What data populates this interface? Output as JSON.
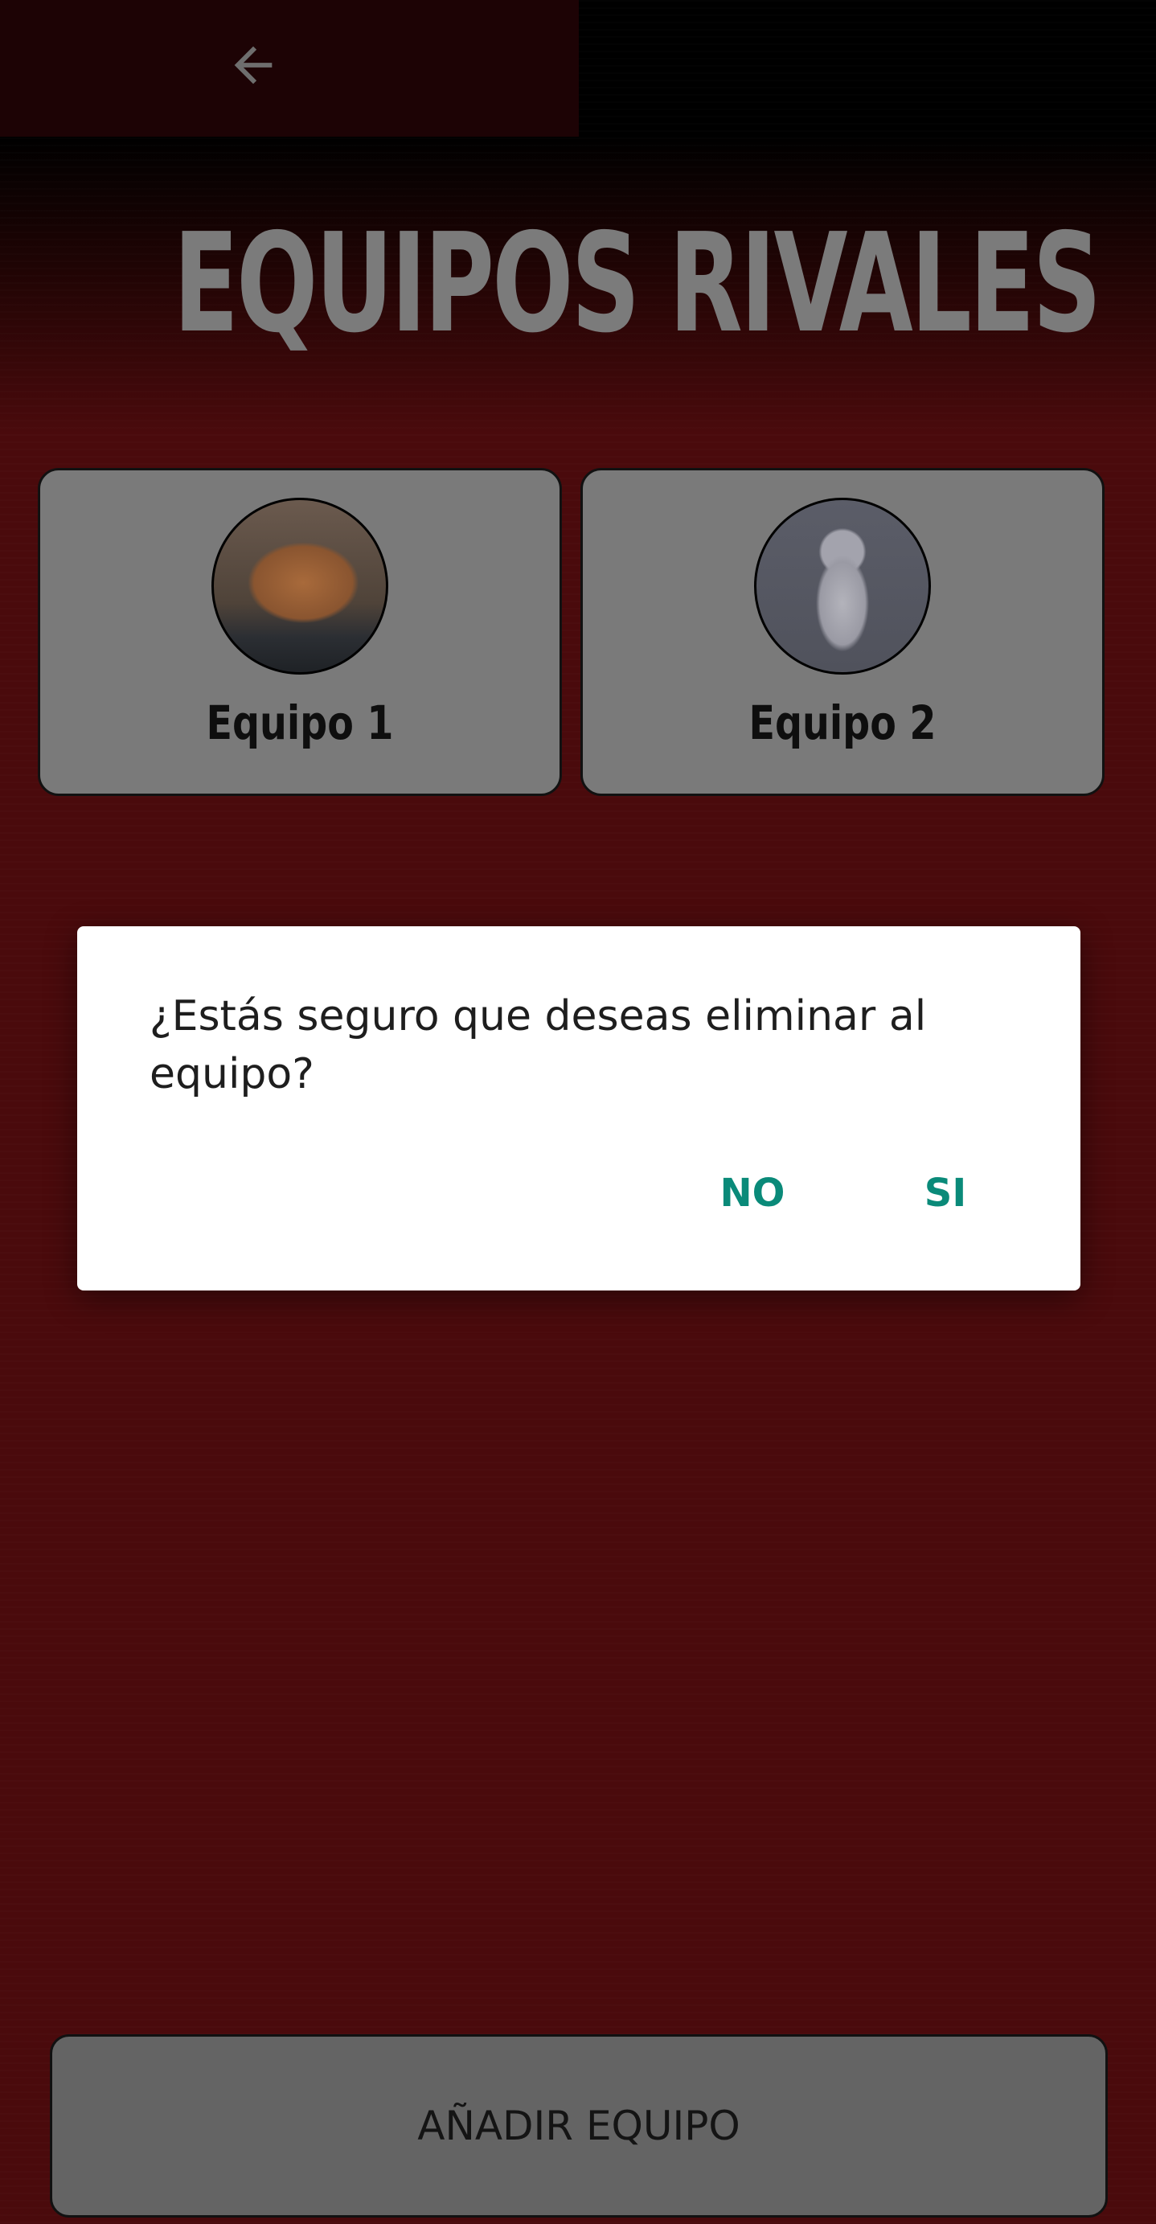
{
  "header": {
    "back_icon": "arrow-left-icon"
  },
  "page": {
    "title": "EQUIPOS RIVALES"
  },
  "teams": [
    {
      "name": "Equipo 1",
      "avatar": "orange sleeping cat photo"
    },
    {
      "name": "Equipo 2",
      "avatar": "white kitten photo"
    }
  ],
  "dialog": {
    "message": "¿Estás seguro que deseas eliminar al equipo?",
    "no_label": "NO",
    "yes_label": "SI"
  },
  "footer": {
    "add_team_label": "AÑADIR EQUIPO"
  },
  "colors": {
    "background": "#4a0a0c",
    "accent": "#0a8a79",
    "card": "#7a7a7a",
    "title": "#7b7b7b"
  }
}
